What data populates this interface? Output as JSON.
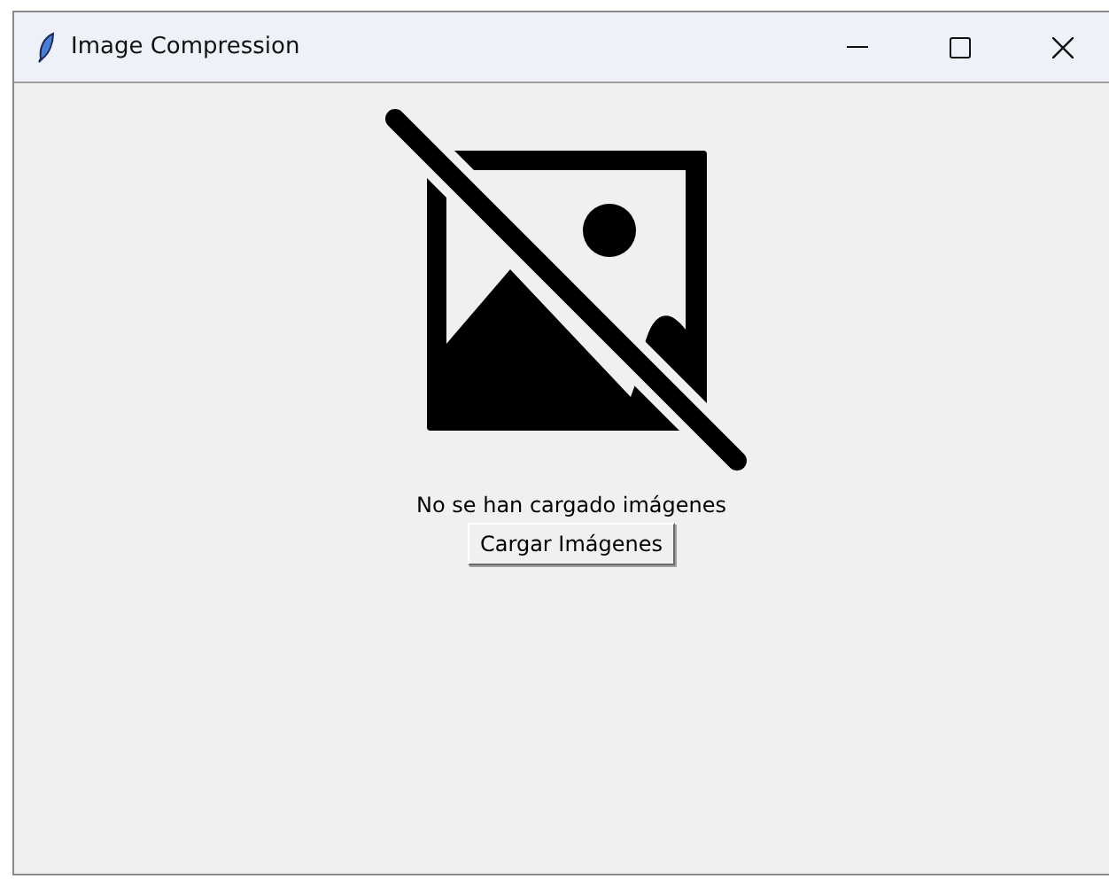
{
  "window": {
    "title": "Image Compression"
  },
  "status": {
    "message": "No se han cargado imágenes"
  },
  "buttons": [
    {
      "label": "Cargar Imágenes"
    }
  ]
}
